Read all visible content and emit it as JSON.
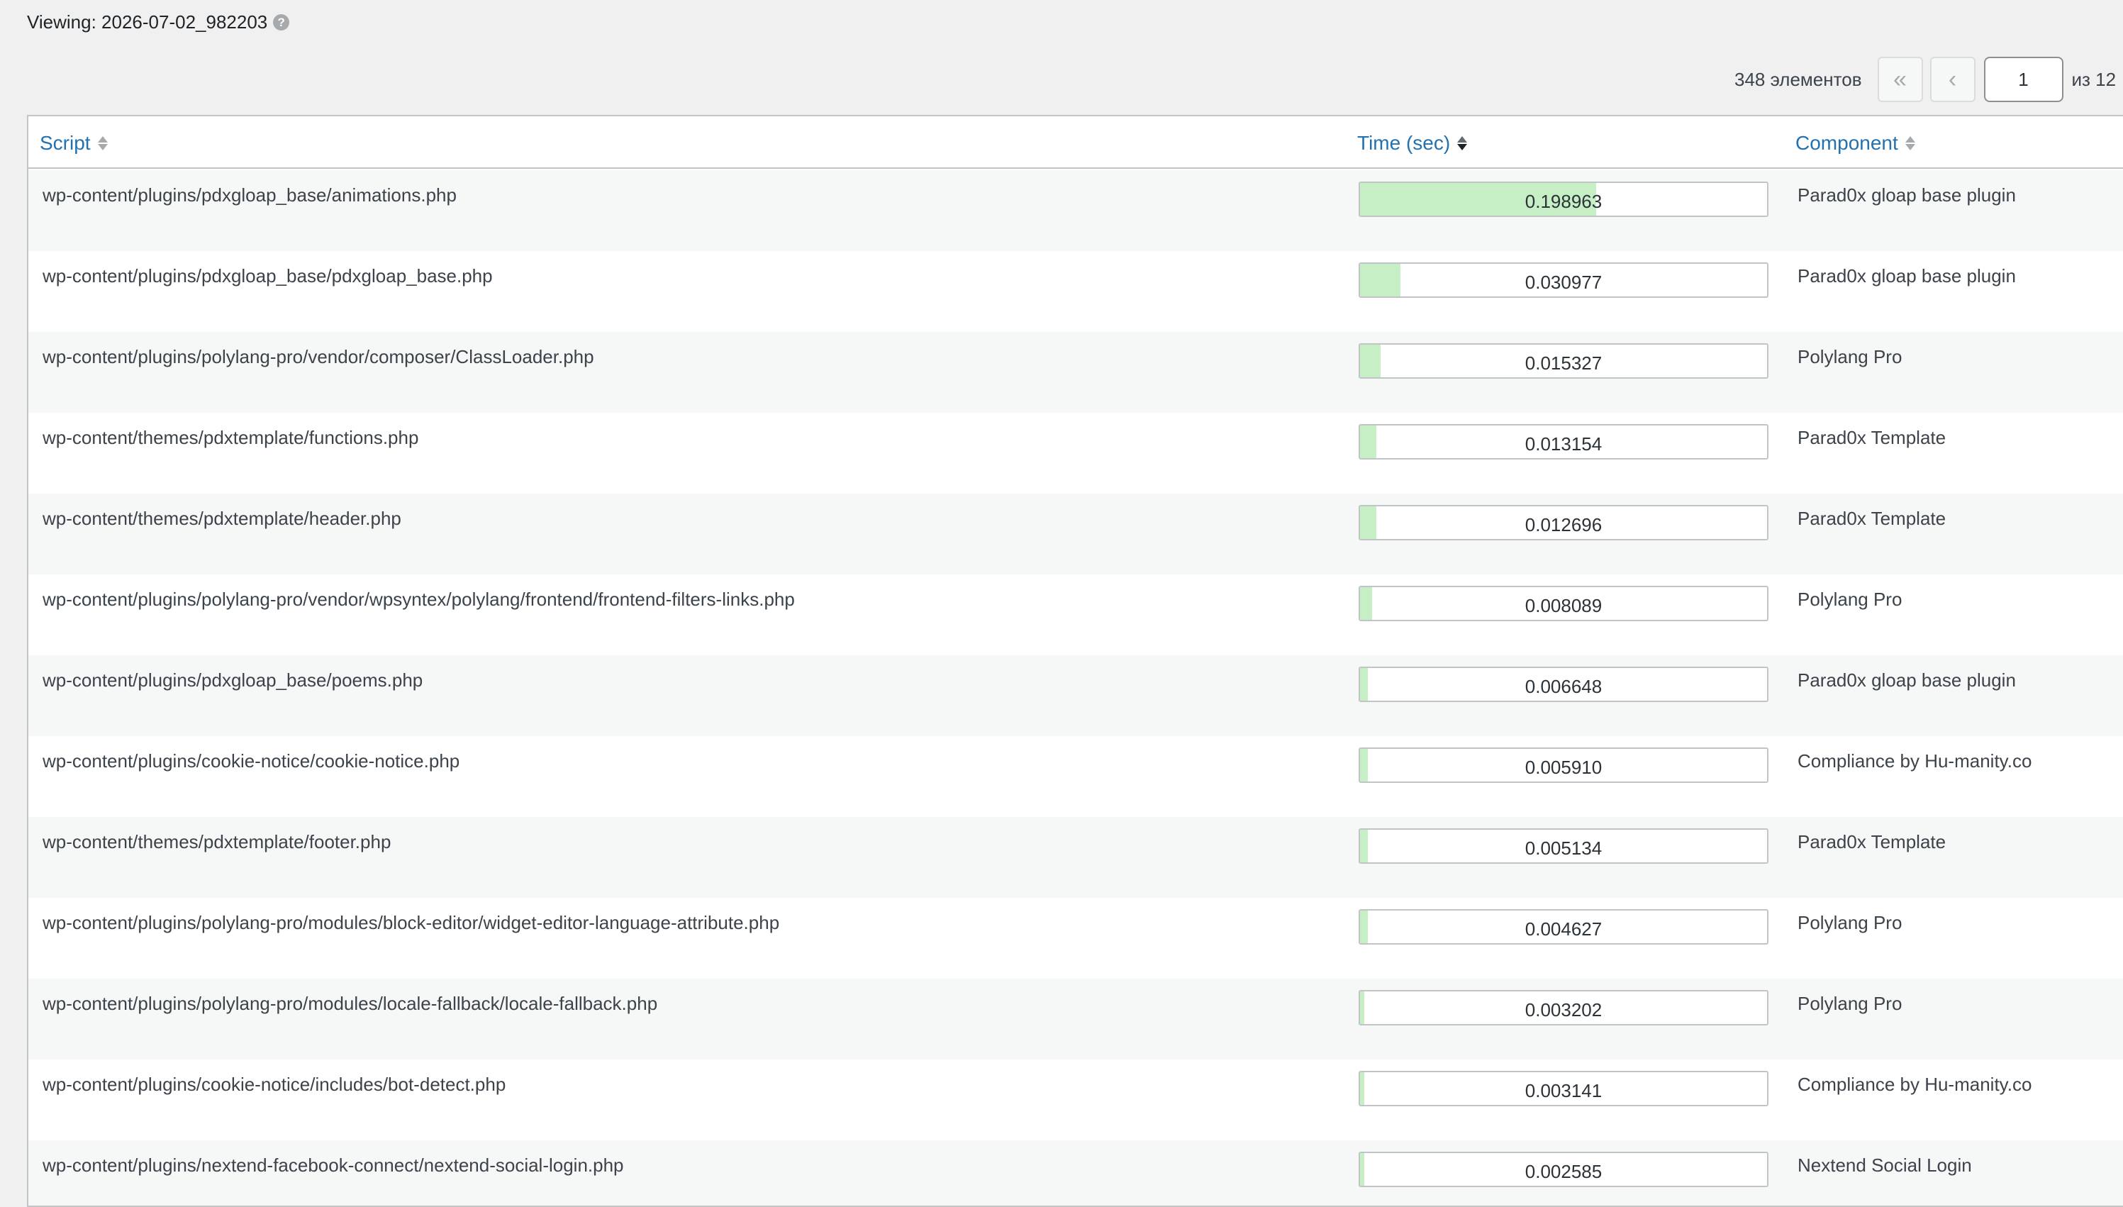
{
  "viewing": {
    "label": "Viewing: 2026-07-02_982203",
    "help_icon": "help-icon"
  },
  "pagination": {
    "count": "348 элементов",
    "first_label": "«",
    "prev_label": "‹",
    "current_page": "1",
    "of_label": "из 12"
  },
  "table": {
    "columns": {
      "script": "Script",
      "time": "Time (sec)",
      "component": "Component"
    },
    "max_time": 0.2,
    "rows": [
      {
        "script": "wp-content/plugins/pdxgloap_base/animations.php",
        "time": "0.198963",
        "fraction": 0.58,
        "component": "Parad0x gloap base plugin"
      },
      {
        "script": "wp-content/plugins/pdxgloap_base/pdxgloap_base.php",
        "time": "0.030977",
        "fraction": 0.1,
        "component": "Parad0x gloap base plugin"
      },
      {
        "script": "wp-content/plugins/polylang-pro/vendor/composer/ClassLoader.php",
        "time": "0.015327",
        "fraction": 0.05,
        "component": "Polylang Pro"
      },
      {
        "script": "wp-content/themes/pdxtemplate/functions.php",
        "time": "0.013154",
        "fraction": 0.04,
        "component": "Parad0x Template"
      },
      {
        "script": "wp-content/themes/pdxtemplate/header.php",
        "time": "0.012696",
        "fraction": 0.04,
        "component": "Parad0x Template"
      },
      {
        "script": "wp-content/plugins/polylang-pro/vendor/wpsyntex/polylang/frontend/frontend-filters-links.php",
        "time": "0.008089",
        "fraction": 0.03,
        "component": "Polylang Pro"
      },
      {
        "script": "wp-content/plugins/pdxgloap_base/poems.php",
        "time": "0.006648",
        "fraction": 0.02,
        "component": "Parad0x gloap base plugin"
      },
      {
        "script": "wp-content/plugins/cookie-notice/cookie-notice.php",
        "time": "0.005910",
        "fraction": 0.02,
        "component": "Compliance by Hu-manity.co"
      },
      {
        "script": "wp-content/themes/pdxtemplate/footer.php",
        "time": "0.005134",
        "fraction": 0.02,
        "component": "Parad0x Template"
      },
      {
        "script": "wp-content/plugins/polylang-pro/modules/block-editor/widget-editor-language-attribute.php",
        "time": "0.004627",
        "fraction": 0.02,
        "component": "Polylang Pro"
      },
      {
        "script": "wp-content/plugins/polylang-pro/modules/locale-fallback/locale-fallback.php",
        "time": "0.003202",
        "fraction": 0.01,
        "component": "Polylang Pro"
      },
      {
        "script": "wp-content/plugins/cookie-notice/includes/bot-detect.php",
        "time": "0.003141",
        "fraction": 0.01,
        "component": "Compliance by Hu-manity.co"
      },
      {
        "script": "wp-content/plugins/nextend-facebook-connect/nextend-social-login.php",
        "time": "0.002585",
        "fraction": 0.01,
        "component": "Nextend Social Login"
      }
    ]
  }
}
